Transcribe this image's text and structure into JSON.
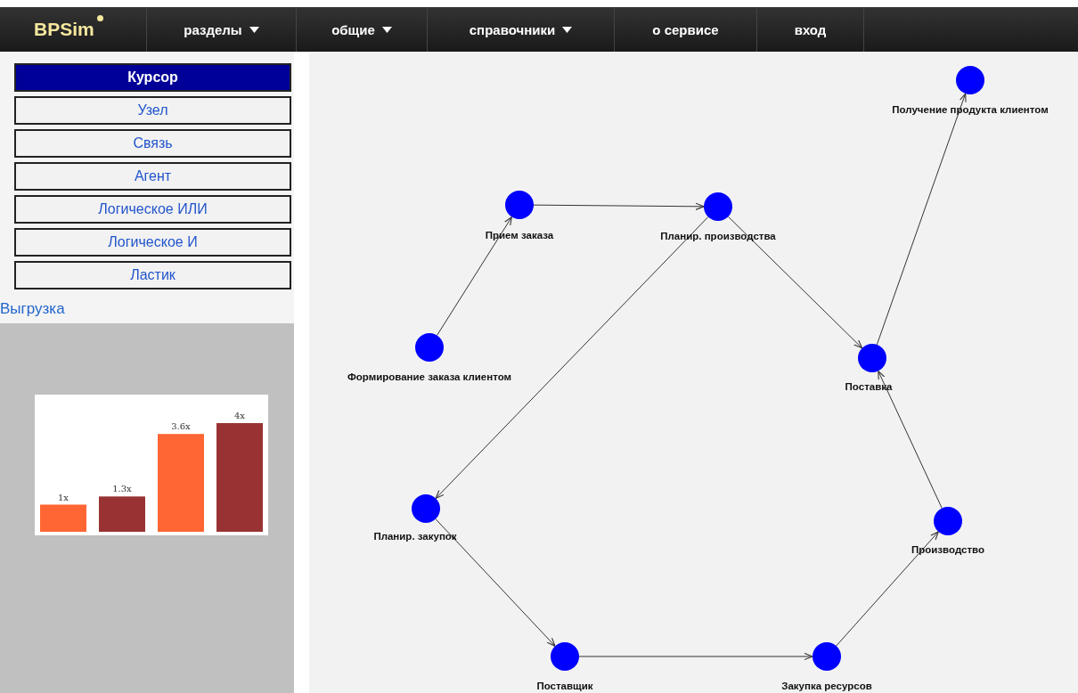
{
  "navbar": {
    "logo": "BPSim",
    "items": [
      {
        "label": "разделы",
        "dropdown": true
      },
      {
        "label": "общие",
        "dropdown": true
      },
      {
        "label": "справочники",
        "dropdown": true
      },
      {
        "label": "о сервисе",
        "dropdown": false
      },
      {
        "label": "вход",
        "dropdown": false
      }
    ]
  },
  "tools": [
    {
      "label": "Курсор",
      "selected": true
    },
    {
      "label": "Узел",
      "selected": false
    },
    {
      "label": "Связь",
      "selected": false
    },
    {
      "label": "Агент",
      "selected": false
    },
    {
      "label": "Логическое ИЛИ",
      "selected": false
    },
    {
      "label": "Логическое И",
      "selected": false
    },
    {
      "label": "Ластик",
      "selected": false
    }
  ],
  "export_link": "Выгрузка",
  "chart": {
    "chart_data": {
      "type": "bar",
      "values": [
        1,
        1.3,
        3.6,
        4
      ],
      "colors": [
        "#ff6633",
        "#993333",
        "#ff6633",
        "#993333"
      ],
      "data_labels": true,
      "value_labels": [
        "1x",
        "1.3x",
        "3.6x",
        "4x"
      ]
    }
  },
  "diagram": {
    "nodes": [
      {
        "label": "Формирование заказа клиентом"
      },
      {
        "label": "Прием заказа"
      },
      {
        "label": "Планир. производства"
      },
      {
        "label": "Поставка"
      },
      {
        "label": "Получение продукта клиентом"
      },
      {
        "label": "Планир. закупок"
      },
      {
        "label": "Поставщик"
      },
      {
        "label": "Закупка ресурсов"
      },
      {
        "label": "Производство"
      }
    ]
  }
}
